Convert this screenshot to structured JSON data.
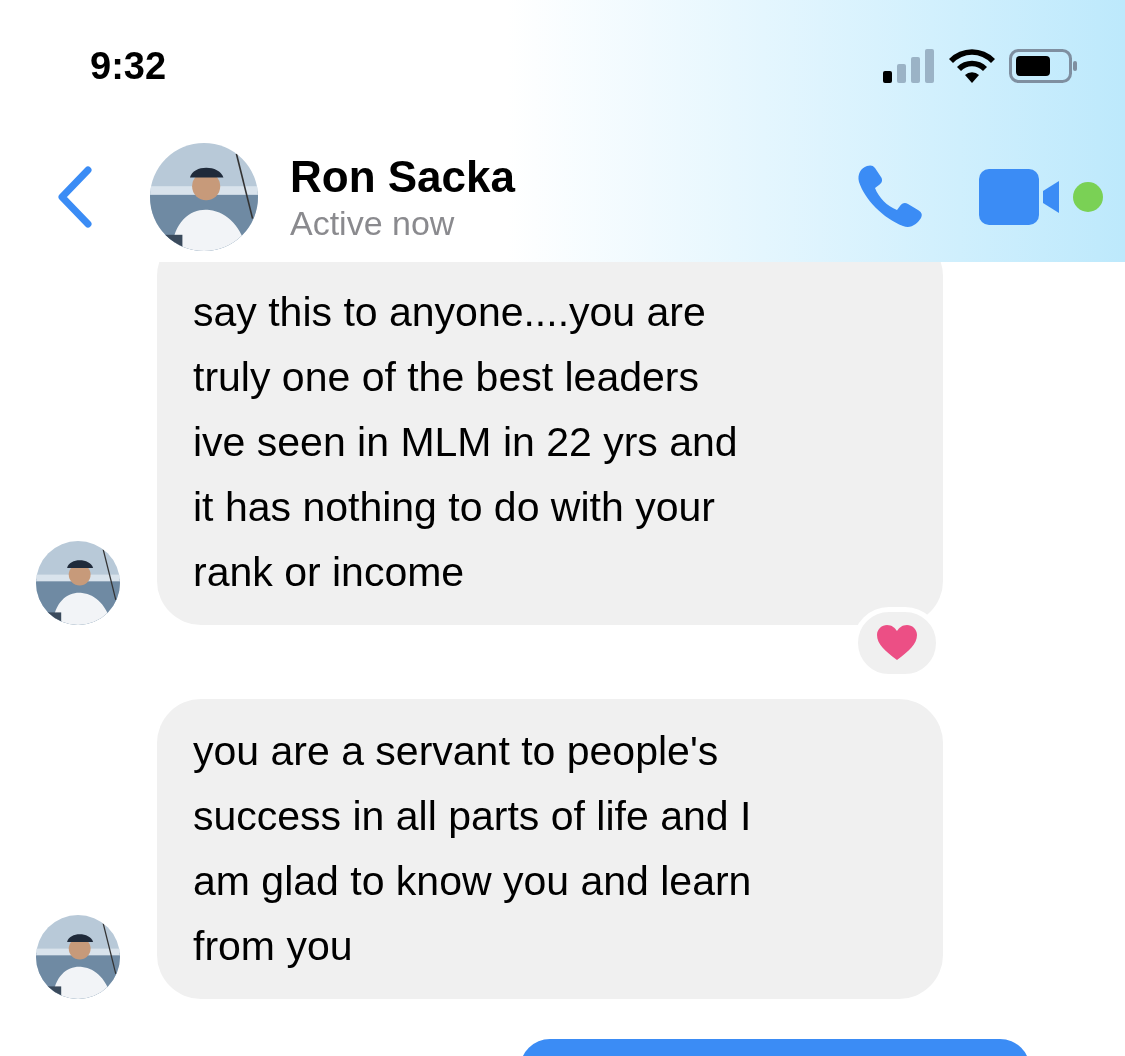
{
  "status_bar": {
    "time": "9:32"
  },
  "header": {
    "name": "Ron Sacka",
    "status": "Active now",
    "online": true
  },
  "messages": [
    {
      "kind": "incoming",
      "text": "say this to anyone....you are\ntruly one of the best leaders\nive seen in MLM in 22 yrs and\nit has nothing to do with your\nrank or income",
      "cut_top": true,
      "reaction": true
    },
    {
      "kind": "incoming",
      "text": "you are a servant to people's\nsuccess in all parts of life and I\nam glad to know you and learn\nfrom you",
      "cut_top": false,
      "reaction": false
    },
    {
      "kind": "outgoing_cut"
    }
  ]
}
